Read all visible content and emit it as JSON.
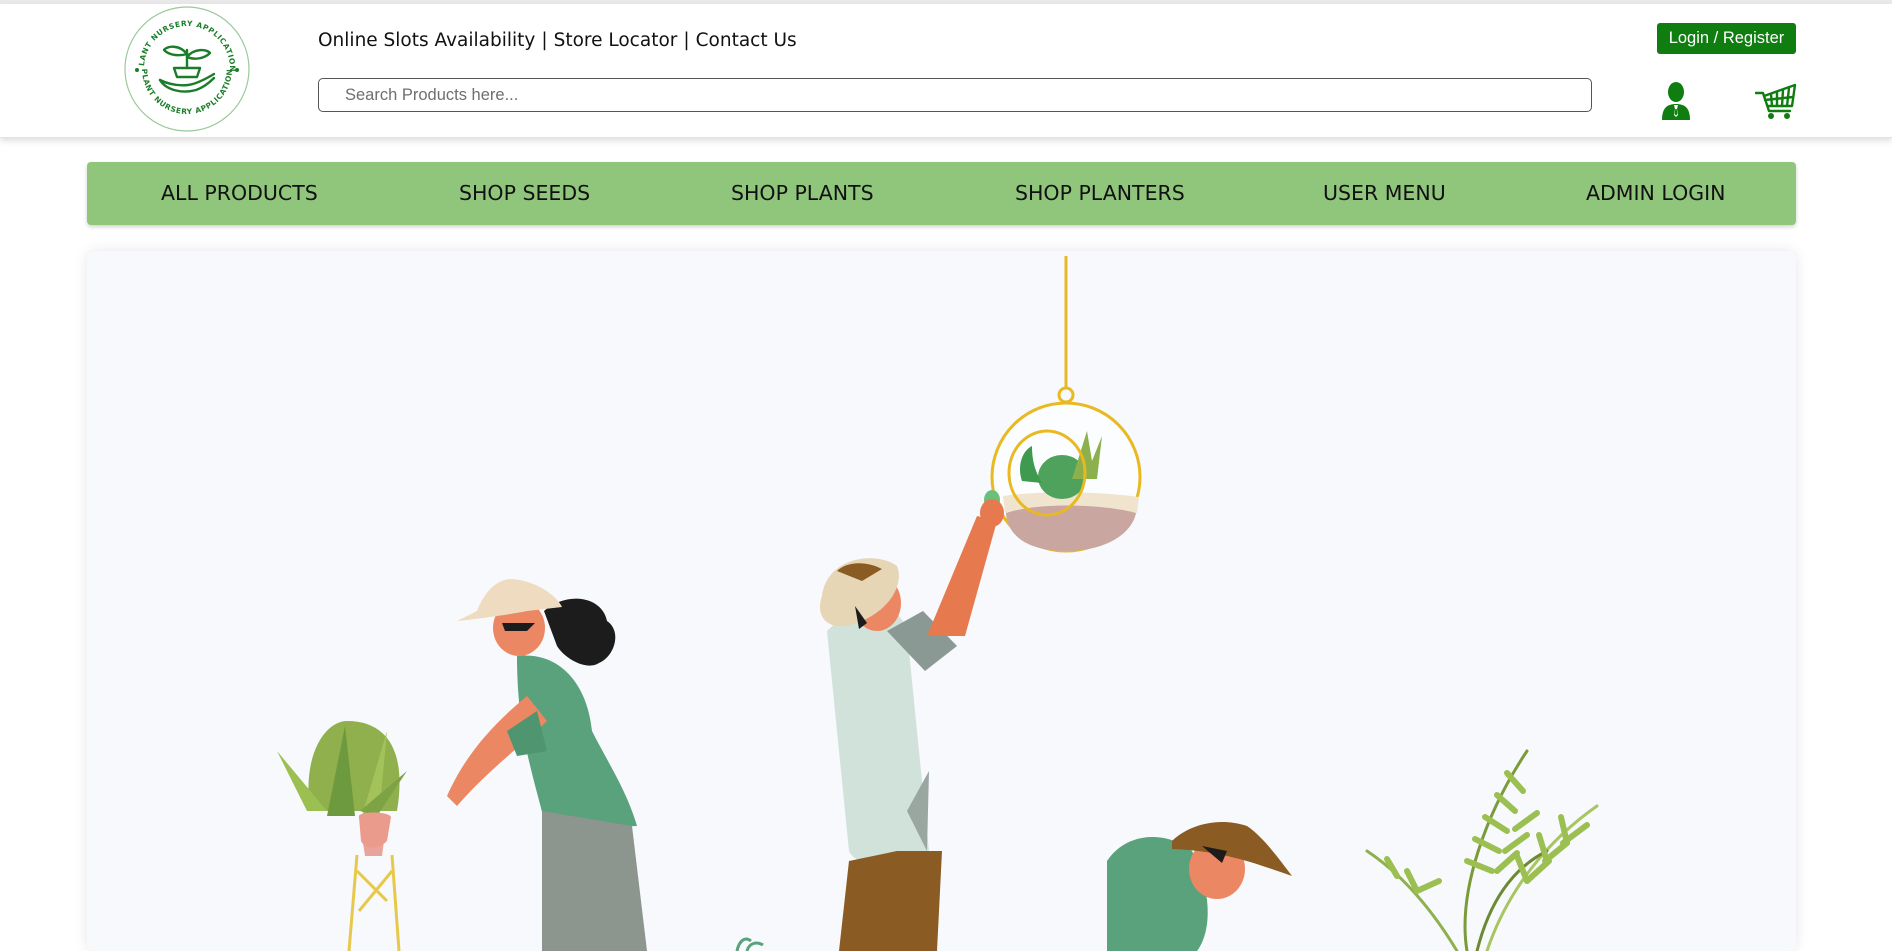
{
  "header": {
    "logo_text_top": "PLANT NURSERY APPLICATION",
    "logo_text_bottom": "PLANT NURSERY APPLICATION",
    "links": [
      "Online Slots Availability",
      "Store Locator",
      "Contact Us"
    ],
    "separator": "|",
    "search_placeholder": "Search Products here...",
    "search_value": "",
    "login_label": "Login / Register",
    "user_icon": "user-icon",
    "cart_icon": "cart-icon"
  },
  "nav": {
    "items": [
      "ALL PRODUCTS",
      "SHOP SEEDS",
      "SHOP PLANTS",
      "SHOP PLANTERS",
      "USER MENU",
      "ADMIN LOGIN"
    ]
  },
  "hero": {
    "illustration": "gardeners-illustration"
  },
  "colors": {
    "brand_green": "#0f7d0f",
    "nav_green": "#8fc67c",
    "hero_bg": "#f7f9fc"
  }
}
